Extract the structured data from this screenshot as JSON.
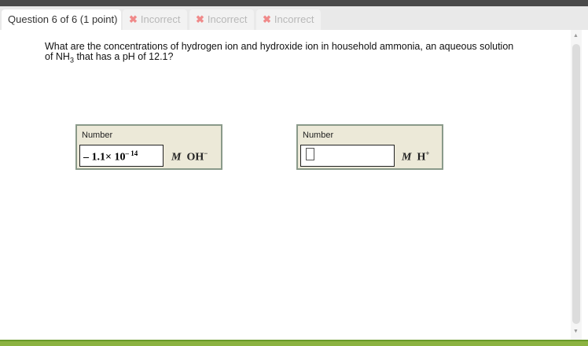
{
  "tabs": {
    "active": "Question 6 of 6 (1 point)",
    "attempts": [
      {
        "label": "Incorrect",
        "icon": "x-icon"
      },
      {
        "label": "Incorrect",
        "icon": "x-icon"
      },
      {
        "label": "Incorrect",
        "icon": "x-icon"
      }
    ]
  },
  "question": {
    "text_before": "What are the concentrations of hydrogen ion and hydroxide ion in household ammonia, an aqueous solution of NH",
    "sub": "3",
    "text_after": " that has a pH of 12.1?"
  },
  "answers": [
    {
      "label": "Number",
      "value_mantissa": "– 1.1× 10",
      "value_exp": "– 14",
      "unit": "M",
      "species": "OH",
      "charge": "−"
    },
    {
      "label": "Number",
      "value": "",
      "unit": "M",
      "species": "H",
      "charge": "+"
    }
  ],
  "colors": {
    "accent": "#8cb341",
    "incorrect": "#f08a8a"
  }
}
